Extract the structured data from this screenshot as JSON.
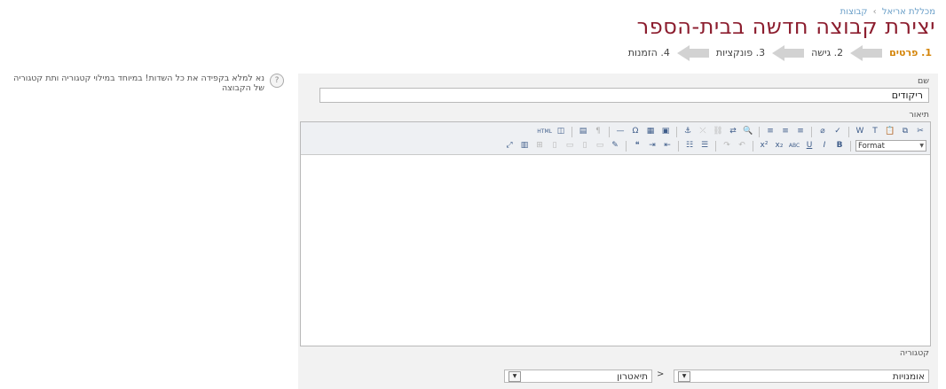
{
  "breadcrumb": {
    "item1": "מכללת אריאל",
    "separator": "›",
    "item2": "קבוצות"
  },
  "page_title": "יצירת קבוצה חדשה בבית-הספר",
  "wizard_steps": [
    {
      "label": "1. פרטים",
      "active": true
    },
    {
      "label": "2. גישה",
      "active": false
    },
    {
      "label": "3. פונקציות",
      "active": false
    },
    {
      "label": "4. הזמנות",
      "active": false
    }
  ],
  "help": {
    "icon": "question-icon",
    "text": "נא למלא בקפידה את כל השדות! במיוחד במילוי קטגוריה ותת קטגוריה של הקבוצה"
  },
  "form": {
    "name_label": "שם",
    "name_value": "ריקודים",
    "description_label": "תיאור",
    "category_label": "קטגוריה",
    "category_value": "אומנויות",
    "subcategory_separator": ">",
    "subcategory_value": "תיאטרון"
  },
  "editor": {
    "format_select": "Format"
  },
  "colors": {
    "title": "#8c1d2e",
    "active_step": "#d4850a",
    "link": "#6a9fc8",
    "panel": "#f2f2f2"
  }
}
